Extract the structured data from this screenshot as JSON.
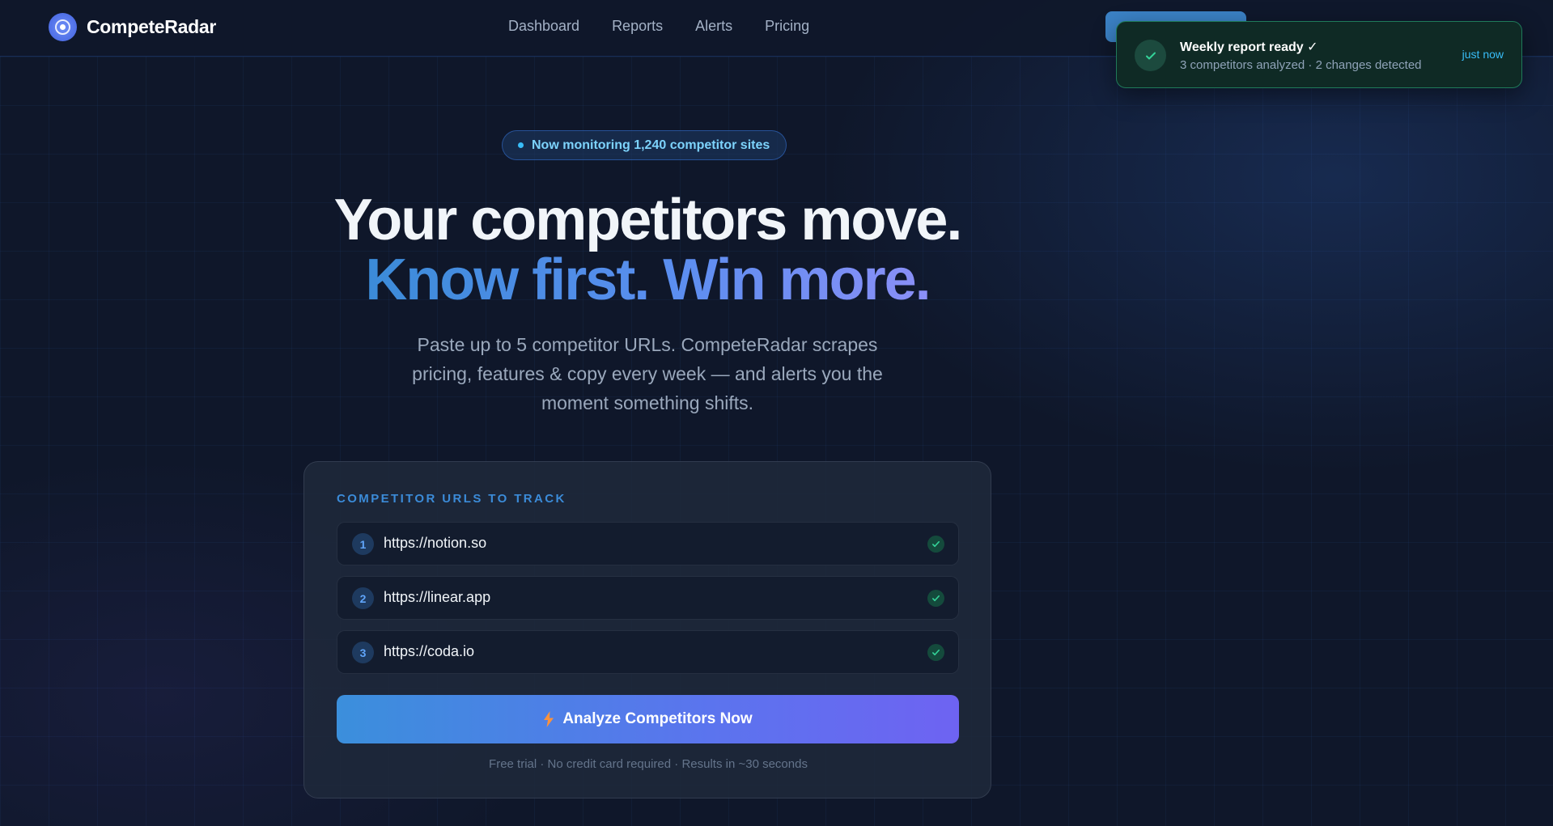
{
  "brand": {
    "name": "CompeteRadar"
  },
  "nav": {
    "links": [
      "Dashboard",
      "Reports",
      "Alerts",
      "Pricing"
    ]
  },
  "toast": {
    "title": "Weekly report ready ✓",
    "subtitle": "3 competitors analyzed · 2 changes detected",
    "time": "just now"
  },
  "hero": {
    "badge": "Now monitoring 1,240 competitor sites",
    "headline_1": "Your competitors move.",
    "headline_2": "Know first. Win more.",
    "lead": "Paste up to 5 competitor URLs. CompeteRadar scrapes pricing, features & copy every week — and alerts you the moment something shifts."
  },
  "form": {
    "label": "COMPETITOR URLS TO TRACK",
    "urls": [
      {
        "num": "1",
        "url": "https://notion.so"
      },
      {
        "num": "2",
        "url": "https://linear.app"
      },
      {
        "num": "3",
        "url": "https://coda.io"
      }
    ],
    "submit_label": "Analyze Competitors Now",
    "fineprint": "Free trial · No credit card required · Results in ~30 seconds"
  },
  "colors": {
    "background": "#0f172a",
    "accent": "#3b82c6",
    "success": "#1f7a5a"
  }
}
